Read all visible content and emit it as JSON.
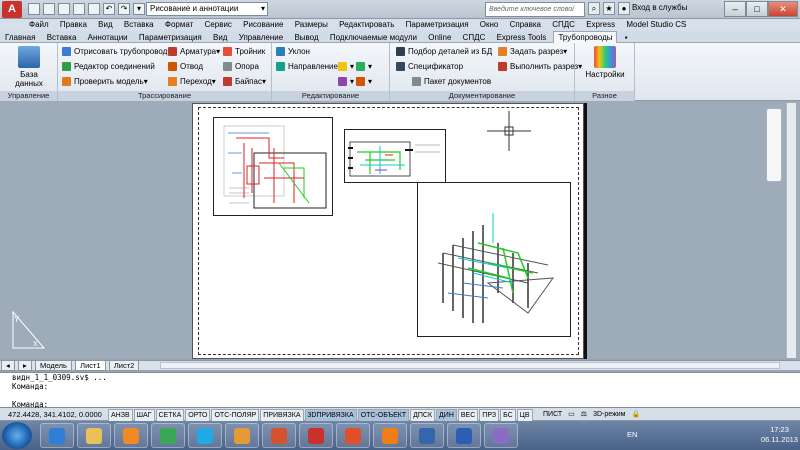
{
  "titlebar": {
    "workspace": "Рисование и аннотации",
    "search_placeholder": "Введите ключевое слово/фразу",
    "login": "Вход в службы",
    "minimize": "–",
    "maximize": "□",
    "close": "✕"
  },
  "menu": [
    "Файл",
    "Правка",
    "Вид",
    "Вставка",
    "Формат",
    "Сервис",
    "Рисование",
    "Размеры",
    "Редактировать",
    "Параметризация",
    "Окно",
    "Справка",
    "СПДС",
    "Express",
    "Model Studio CS"
  ],
  "ribbon_tabs": [
    "Главная",
    "Вставка",
    "Аннотации",
    "Параметризация",
    "Вид",
    "Управление",
    "Вывод",
    "Подключаемые модули",
    "Online",
    "СПДС",
    "Express Tools",
    "Трубопроводы"
  ],
  "active_tab": "Трубопроводы",
  "groups": {
    "management": {
      "title": "Управление",
      "db_button": "База данных"
    },
    "routing": {
      "title": "Трассирование",
      "draw_pipe": "Отрисовать трубопровод",
      "joint_editor": "Редактор соединений",
      "check_model": "Проверить модель",
      "fittings": "Арматура",
      "bend": "Отвод",
      "transition": "Переход",
      "tee": "Тройник",
      "support": "Опора",
      "bypass": "Байпас"
    },
    "editing": {
      "title": "Редактирование",
      "slope": "Уклон",
      "direction": "Направление"
    },
    "documentation": {
      "title": "Документирование",
      "select_parts": "Подбор деталей из БД",
      "specifier": "Спецификатор",
      "doc_package": "Пакет документов",
      "set_cut": "Задать разрез",
      "make_cut": "Выполнить разрез"
    },
    "misc": {
      "title": "Разное",
      "settings": "Настройки"
    }
  },
  "layout_tabs": [
    "Модель",
    "Лист1",
    "Лист2"
  ],
  "active_layout": "Лист1",
  "command_lines": [
    "видн_1_1_0309.sv$ ...",
    "Команда:",
    "Команда:"
  ],
  "status": {
    "coords": "472.4428, 341.4102, 0.0000",
    "modes": [
      {
        "label": "АНЗВ",
        "on": false
      },
      {
        "label": "ШАГ",
        "on": false
      },
      {
        "label": "СЕТКА",
        "on": false
      },
      {
        "label": "ОРТО",
        "on": false
      },
      {
        "label": "ОТС-ПОЛЯР",
        "on": false
      },
      {
        "label": "ПРИВЯЗКА",
        "on": false
      },
      {
        "label": "3DПРИВЯЗКА",
        "on": true
      },
      {
        "label": "ОТС-ОБЪЕКТ",
        "on": true
      },
      {
        "label": "ДПСК",
        "on": false
      },
      {
        "label": "ДИН",
        "on": true
      },
      {
        "label": "ВЕС",
        "on": false
      },
      {
        "label": "ПРЗ",
        "on": false
      },
      {
        "label": "БС",
        "on": false
      },
      {
        "label": "ЦВ",
        "on": false
      }
    ],
    "sheet": "ПИСТ",
    "workspace_3d": "3D-режим"
  },
  "taskbar": {
    "lang": "EN",
    "time": "17:23",
    "date": "06.11.2013",
    "apps": [
      {
        "name": "ie-icon",
        "color": "#2d7fd8"
      },
      {
        "name": "explorer-icon",
        "color": "#e8c15a"
      },
      {
        "name": "media-player-icon",
        "color": "#f08a24"
      },
      {
        "name": "chrome-icon",
        "color": "#3aa757"
      },
      {
        "name": "skype-icon",
        "color": "#20a9e5"
      },
      {
        "name": "paint-icon",
        "color": "#e59a3a"
      },
      {
        "name": "powerpoint-icon",
        "color": "#d5522e"
      },
      {
        "name": "autocad-icon",
        "color": "#c9312a"
      },
      {
        "name": "foxit-icon",
        "color": "#e0512b"
      },
      {
        "name": "vlc-icon",
        "color": "#ef7e1a"
      },
      {
        "name": "app-icon",
        "color": "#3366aa"
      },
      {
        "name": "word-icon",
        "color": "#2b5fb4"
      },
      {
        "name": "paint-palette-icon",
        "color": "#8a6cc4"
      }
    ]
  },
  "colors": {
    "accent": "#c9312a",
    "pipe_green": "#22cc22",
    "pipe_cyan": "#00cccc",
    "pipe_red": "#dd2222"
  }
}
